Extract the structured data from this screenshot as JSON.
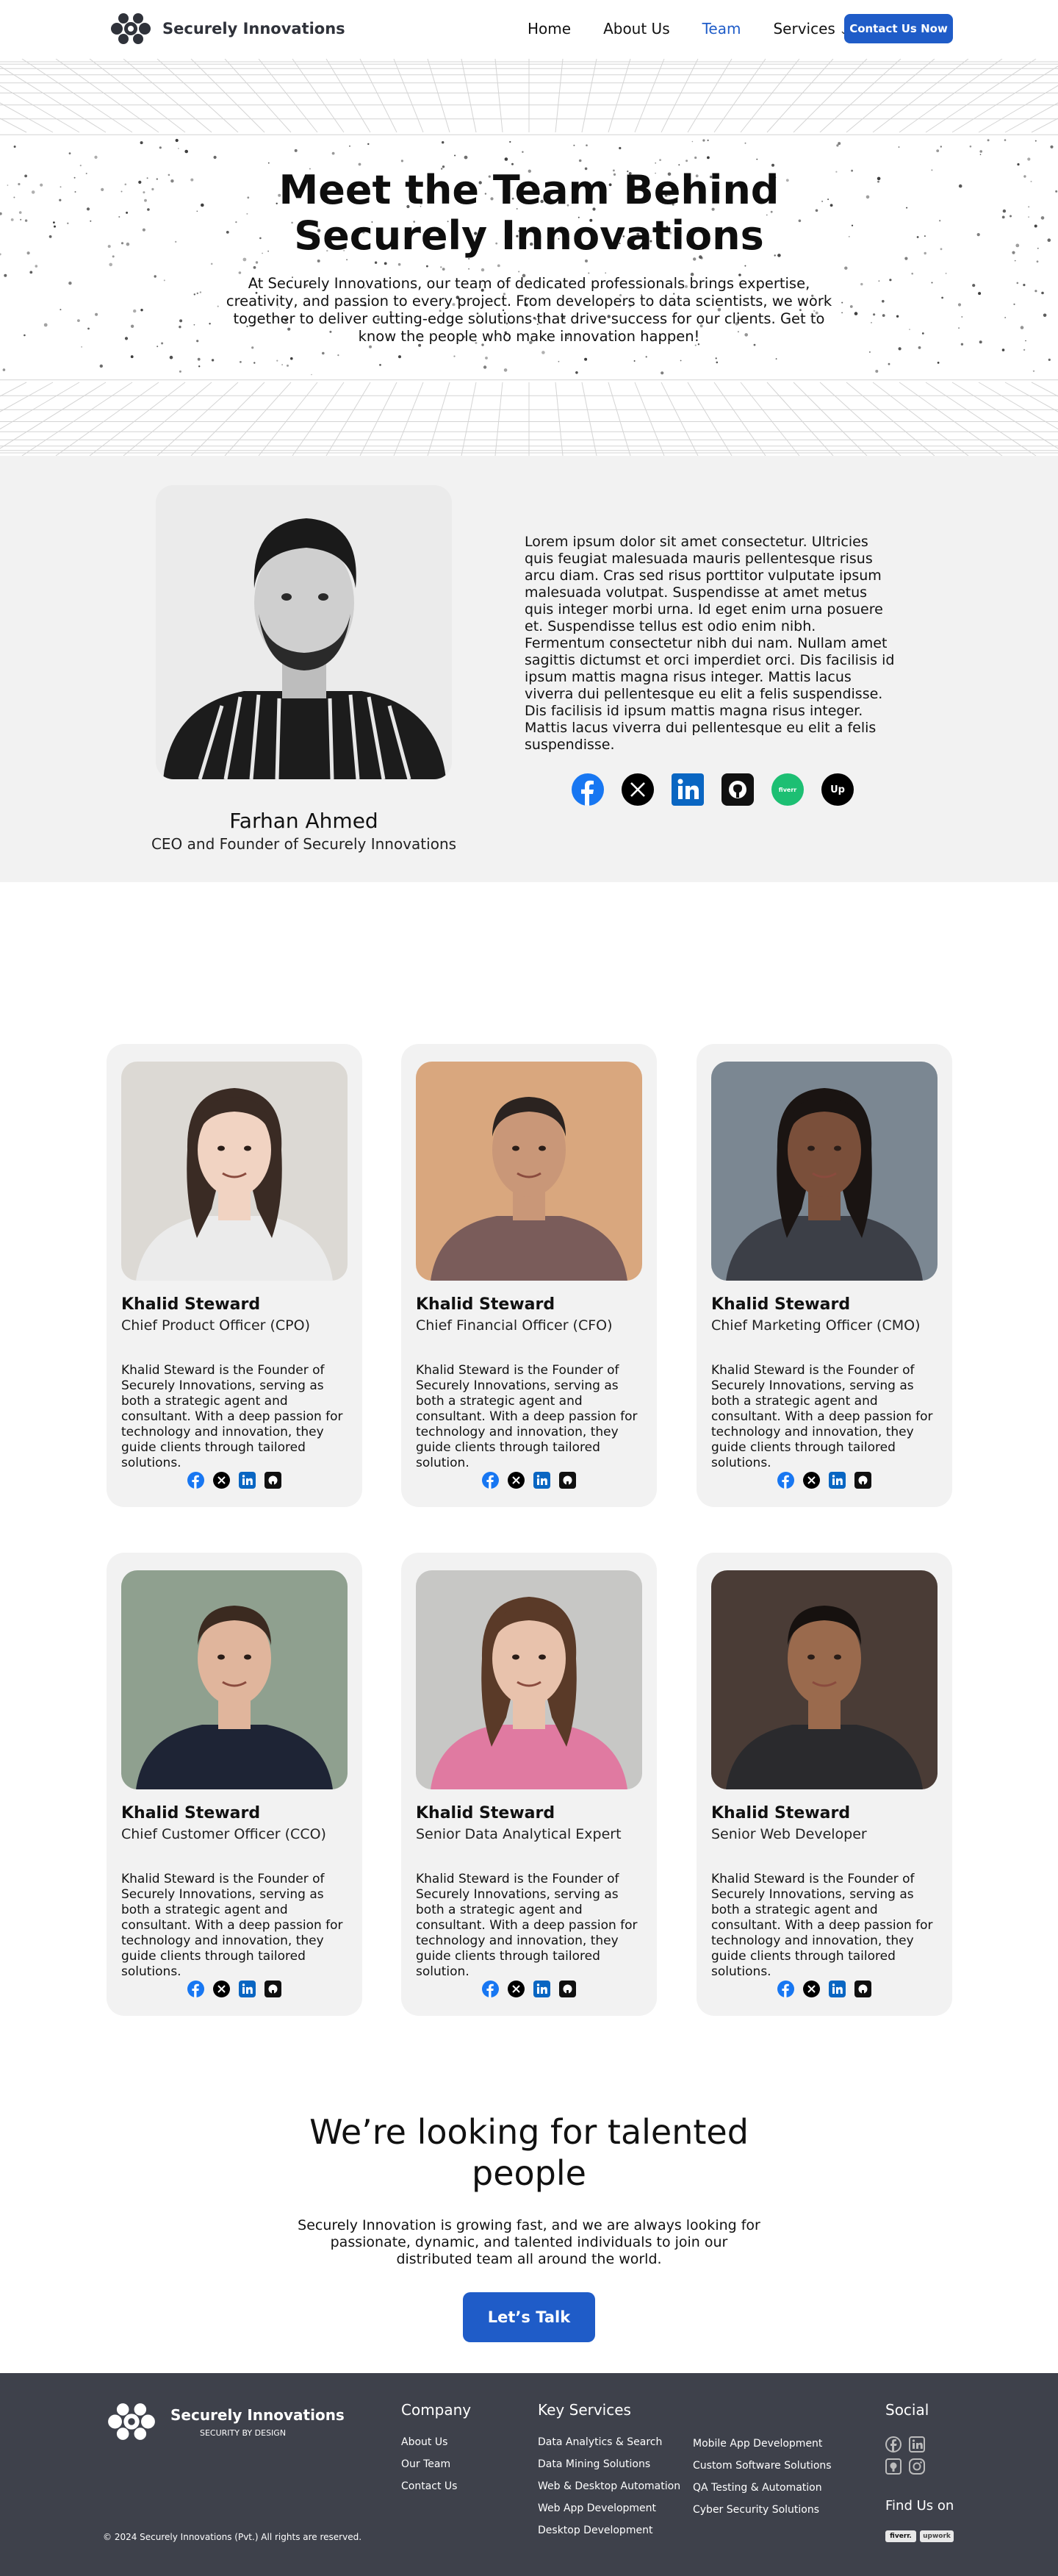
{
  "nav": {
    "brand": "Securely Innovations",
    "items": [
      {
        "label": "Home",
        "active": false
      },
      {
        "label": "About Us",
        "active": false
      },
      {
        "label": "Team",
        "active": true
      },
      {
        "label": "Services",
        "active": false
      }
    ],
    "cta": "Contact Us Now"
  },
  "hero": {
    "title_line1": "Meet the Team Behind",
    "title_line2": "Securely Innovations",
    "text": "At Securely Innovations, our team of dedicated professionals brings expertise, creativity, and passion to every project. From developers to data scientists, we work together to deliver cutting-edge solutions that drive success for our clients. Get to know the people who make innovation happen!"
  },
  "founder": {
    "name": "Farhan Ahmed",
    "role": "CEO and Founder of Securely Innovations",
    "bio": "Lorem ipsum dolor sit amet consectetur. Ultricies quis feugiat malesuada mauris pellentesque risus arcu diam. Cras sed risus porttitor vulputate ipsum malesuada volutpat. Suspendisse at amet metus quis integer morbi urna. Id eget enim urna posuere et. Suspendisse tellus est odio enim nibh. Fermentum consectetur nibh dui nam. Nullam amet sagittis dictumst et orci imperdiet orci. Dis facilisis id ipsum mattis magna risus integer. Mattis lacus viverra dui pellentesque eu elit a felis suspendisse. Dis facilisis id ipsum mattis magna risus integer. Mattis lacus viverra dui pellentesque eu elit a felis suspendisse.",
    "social": [
      "facebook-icon",
      "x-icon",
      "linkedin-icon",
      "github-icon",
      "fiverr-icon",
      "upwork-icon"
    ]
  },
  "team": [
    {
      "name": "Khalid Steward",
      "role": "Chief Product Officer (CPO)",
      "bio": "Khalid Steward is the Founder of Securely Innovations, serving as both a strategic agent and consultant. With a deep passion for technology and innovation, they guide clients through tailored solutions."
    },
    {
      "name": "Khalid Steward",
      "role": "Chief Financial Officer (CFO)",
      "bio": "Khalid Steward is the Founder of Securely Innovations, serving as both a strategic agent and consultant. With a deep passion for technology and innovation, they guide clients through tailored solution."
    },
    {
      "name": "Khalid Steward",
      "role": "Chief Marketing Officer (CMO)",
      "bio": "Khalid Steward is the Founder of Securely Innovations, serving as both a strategic agent and consultant. With a deep passion for technology and innovation, they guide clients through tailored solutions."
    },
    {
      "name": "Khalid Steward",
      "role": "Chief Customer Officer (CCO)",
      "bio": "Khalid Steward is the Founder of Securely Innovations, serving as both a strategic agent and consultant. With a deep passion for technology and innovation, they guide clients through tailored solutions."
    },
    {
      "name": "Khalid Steward",
      "role": "Senior Data Analytical Expert",
      "bio": "Khalid Steward is the Founder of Securely Innovations, serving as both a strategic agent and consultant. With a deep passion for technology and innovation, they guide clients through tailored solution."
    },
    {
      "name": "Khalid Steward",
      "role": "Senior Web Developer",
      "bio": "Khalid Steward is the Founder of Securely Innovations, serving as both a strategic agent and consultant. With a deep passion for technology and innovation, they guide clients through tailored solutions."
    }
  ],
  "cta": {
    "title_line1": "We’re looking for talented",
    "title_line2": "people",
    "text": "Securely Innovation is growing fast,  and we are always looking for passionate, dynamic, and talented individuals to join our distributed team all around the world.",
    "button": "Let’s Talk"
  },
  "footer": {
    "brand": "Securely Innovations",
    "tagline": "SECURITY BY DESIGN",
    "copyright": "© 2024 Securely Innovations (Pvt.) All rights are reserved.",
    "company_heading": "Company",
    "company_links": [
      "About Us",
      "Our Team",
      "Contact Us"
    ],
    "services_heading": "Key Services",
    "services_col1": [
      "Data Analytics & Search",
      "Data Mining Solutions",
      "Web & Desktop Automation",
      "Web App Development",
      "Desktop Development"
    ],
    "services_col2": [
      "Mobile App Development",
      "Custom Software Solutions",
      "QA Testing & Automation",
      "Cyber Security Solutions"
    ],
    "social_heading": "Social",
    "find_us": "Find Us on",
    "badges": [
      "fiverr.",
      "upwork"
    ]
  },
  "colors": {
    "accent": "#1f5cc8",
    "footer_bg": "#3e414b",
    "section_bg": "#f2f2f2"
  }
}
